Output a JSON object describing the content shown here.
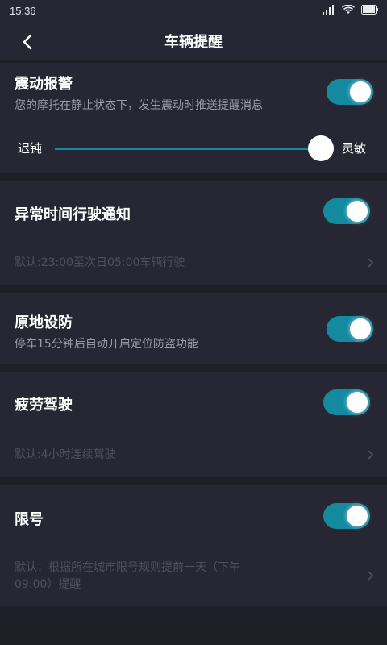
{
  "status_bar": {
    "time": "15:36"
  },
  "header": {
    "title": "车辆提醒",
    "back_icon": "chevron-left-icon"
  },
  "colors": {
    "accent": "#138aa0",
    "background": "#1e1f27",
    "card": "#262733",
    "muted_text": "#9a9ba6",
    "dim_text": "#4e505c"
  },
  "vibration_alarm": {
    "title": "震动报警",
    "description": "您的摩托在静止状态下，发生震动时推送提醒消息",
    "enabled": true,
    "sensitivity": {
      "min_label": "迟钝",
      "max_label": "灵敏",
      "level": 1.0
    }
  },
  "abnormal_time": {
    "title": "异常时间行驶通知",
    "enabled": true,
    "default_text": "默认:23:00至次日05:00车辆行驶"
  },
  "in_place_defense": {
    "title": "原地设防",
    "description": "停车15分钟后自动开启定位防盗功能",
    "enabled": true
  },
  "fatigue_driving": {
    "title": "疲劳驾驶",
    "enabled": true,
    "default_text": "默认:4小时连续驾驶"
  },
  "plate_restriction": {
    "title": "限号",
    "enabled": true,
    "default_text_line1": "默认：根据所在城市限号规则提前一天（下午",
    "default_text_line2": "09:00）提醒"
  }
}
